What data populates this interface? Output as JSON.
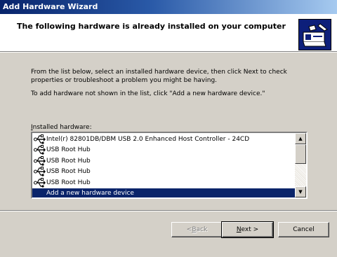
{
  "window": {
    "title": "Add Hardware Wizard"
  },
  "header": {
    "heading": "The following hardware is already installed on your computer",
    "icon": "hardware-wizard-icon"
  },
  "body": {
    "instruction": "From the list below, select an installed hardware device, then click Next to check properties or troubleshoot a problem you might be having.",
    "add_note": "To add hardware not shown in the list, click \"Add a new hardware device.\"",
    "list_label_accel": "I",
    "list_label_rest": "nstalled hardware:"
  },
  "hardware_list": {
    "items": [
      {
        "label": "Intel(r) 82801DB/DBM USB 2.0 Enhanced Host Controller - 24CD",
        "icon": "usb-icon"
      },
      {
        "label": "USB Root Hub",
        "icon": "usb-icon"
      },
      {
        "label": "USB Root Hub",
        "icon": "usb-icon"
      },
      {
        "label": "USB Root Hub",
        "icon": "usb-icon"
      },
      {
        "label": "USB Root Hub",
        "icon": "usb-icon"
      },
      {
        "label": "Add a new hardware device",
        "icon": "",
        "selected": true
      }
    ],
    "scroll_up_glyph": "▲",
    "scroll_down_glyph": "▼"
  },
  "buttons": {
    "back_accel": "B",
    "back_prefix": "< ",
    "back_rest": "ack",
    "next_accel": "N",
    "next_rest": "ext >",
    "cancel": "Cancel"
  },
  "colors": {
    "titlebar_start": "#08246b",
    "titlebar_end": "#a6caf0",
    "dialog_face": "#d4d0c8",
    "selection": "#0a246a"
  }
}
